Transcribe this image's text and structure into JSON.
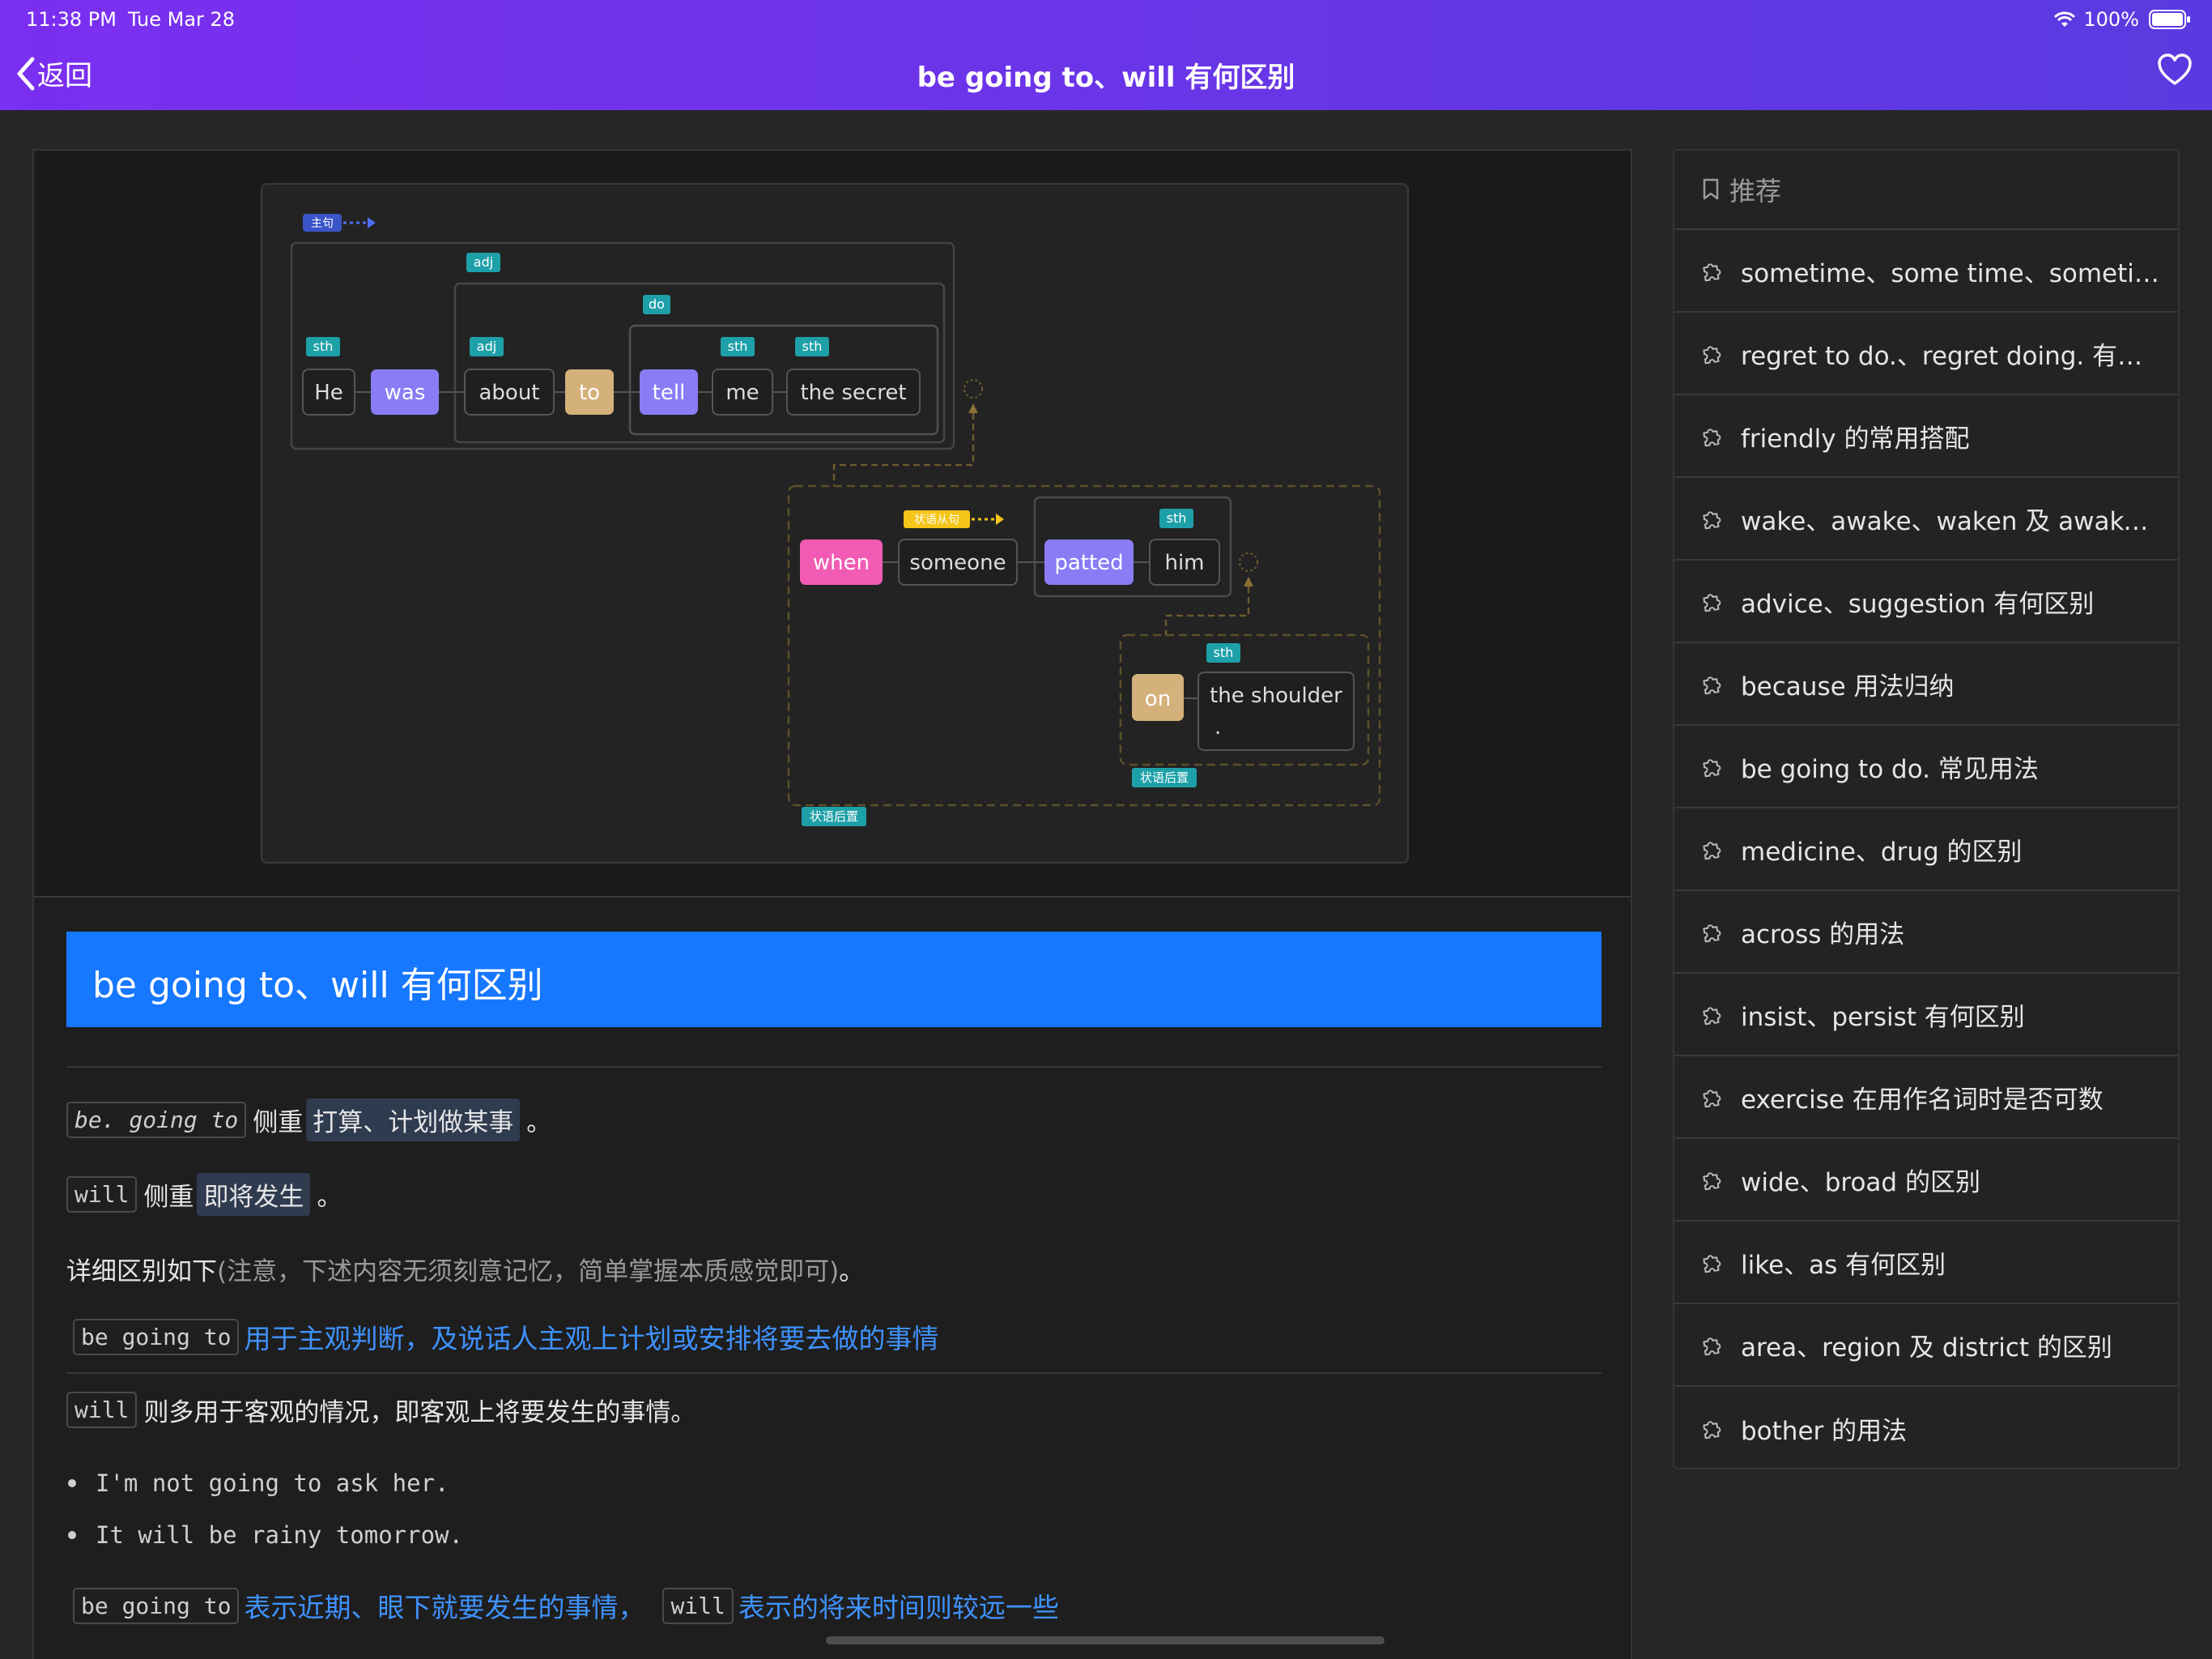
{
  "status": {
    "time": "11:38 PM",
    "date": "Tue Mar 28",
    "battery": "100%"
  },
  "nav": {
    "back_label": "返回",
    "title": "be going to、will 有何区别"
  },
  "diagram": {
    "main_clause_tag": "主句",
    "adverbial_clause_tag": "状语从句",
    "postpos_tag": "状语后置",
    "words": {
      "he": "He",
      "was": "was",
      "about": "about",
      "to": "to",
      "tell": "tell",
      "me": "me",
      "secret": "the secret",
      "when": "when",
      "someone": "someone",
      "patted": "patted",
      "him": "him",
      "on": "on",
      "shoulder": "the shoulder",
      "period": "."
    },
    "tags": {
      "sth": "sth",
      "adj": "adj",
      "do": "do"
    },
    "colors": {
      "purple": "#8a7cf5",
      "tan": "#d4b07a",
      "pink": "#f25bb3",
      "teal": "#1ea0a8",
      "yellow": "#f5c518",
      "blue_tag": "#3a55c8"
    }
  },
  "article": {
    "title": "be going to、will 有何区别",
    "l1": {
      "code": "be. going to",
      "pre": "侧重",
      "hl": "打算、计划做某事",
      "post": "。"
    },
    "l2": {
      "code": "will",
      "pre": "侧重",
      "hl": "即将发生",
      "post": "。"
    },
    "l3": {
      "main": "详细区别如下",
      "note": "(注意，下述内容无须刻意记忆，简单掌握本质感觉即可)",
      "post": "。"
    },
    "h1": {
      "code": "be going to",
      "text": "用于主观判断，及说话人主观上计划或安排将要去做的事情"
    },
    "l4": {
      "code": "will",
      "text": "则多用于客观的情况，即客观上将要发生的事情。"
    },
    "bullets": [
      "I'm not going to ask her.",
      "It will be rainy tomorrow."
    ],
    "h2": {
      "code1": "be going to",
      "text1": "表示近期、眼下就要发生的事情，",
      "code2": "will",
      "text2": "表示的将来时间则较远一些"
    }
  },
  "sidebar": {
    "title": "推荐",
    "items": [
      "sometime、some time、sometimes 的区别",
      "regret to do.、regret doing. 有何区别",
      "friendly 的常用搭配",
      "wake、awake、waken 及 awaken 的区别",
      "advice、suggestion 有何区别",
      "because 用法归纳",
      "be going to do. 常见用法",
      "medicine、drug 的区别",
      "across 的用法",
      "insist、persist 有何区别",
      "exercise 在用作名词时是否可数",
      "wide、broad 的区别",
      "like、as 有何区别",
      "area、region 及 district 的区别",
      "bother 的用法"
    ]
  }
}
